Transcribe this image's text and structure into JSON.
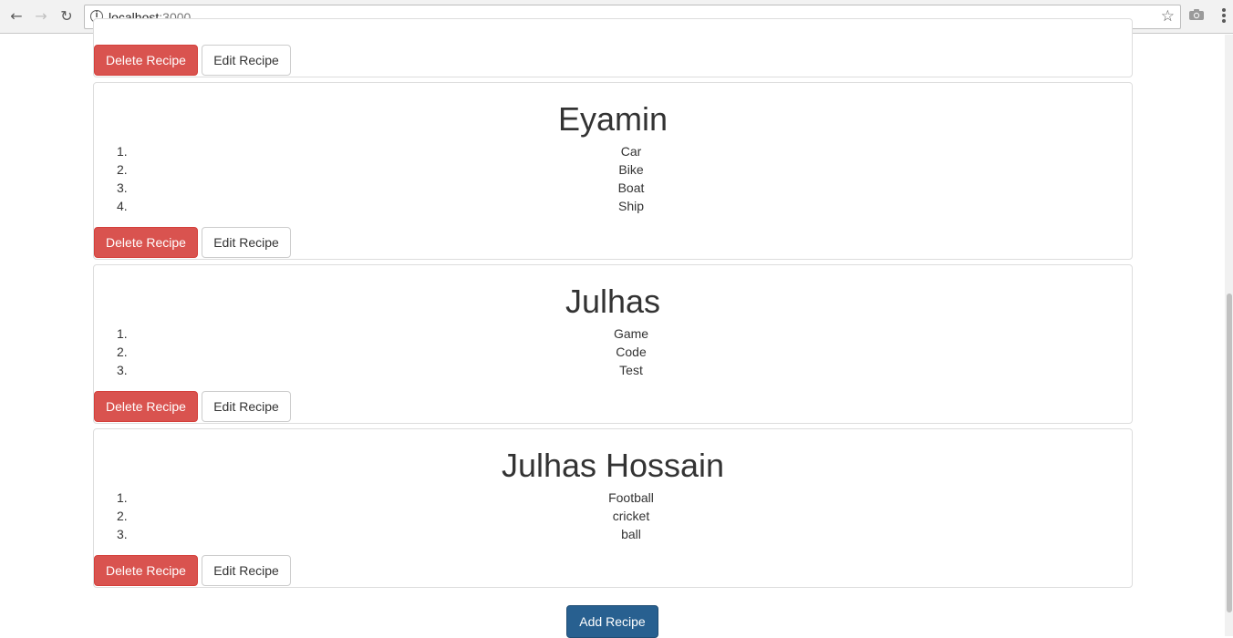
{
  "browser": {
    "url_host": "localhost",
    "url_port": ":3000",
    "back_glyph": "←",
    "forward_glyph": "→",
    "reload_glyph": "↻",
    "info_glyph": "i",
    "star_glyph": "☆"
  },
  "recipes": [
    {
      "title": "",
      "ingredients": [],
      "delete_label": "Delete Recipe",
      "edit_label": "Edit Recipe"
    },
    {
      "title": "Eyamin",
      "ingredients": [
        {
          "num": "1.",
          "name": "Car"
        },
        {
          "num": "2.",
          "name": "Bike"
        },
        {
          "num": "3.",
          "name": "Boat"
        },
        {
          "num": "4.",
          "name": "Ship"
        }
      ],
      "delete_label": "Delete Recipe",
      "edit_label": "Edit Recipe"
    },
    {
      "title": "Julhas",
      "ingredients": [
        {
          "num": "1.",
          "name": "Game"
        },
        {
          "num": "2.",
          "name": "Code"
        },
        {
          "num": "3.",
          "name": "Test"
        }
      ],
      "delete_label": "Delete Recipe",
      "edit_label": "Edit Recipe"
    },
    {
      "title": "Julhas Hossain",
      "ingredients": [
        {
          "num": "1.",
          "name": "Football"
        },
        {
          "num": "2.",
          "name": "cricket"
        },
        {
          "num": "3.",
          "name": "ball"
        }
      ],
      "delete_label": "Delete Recipe",
      "edit_label": "Edit Recipe"
    }
  ],
  "add_button_label": "Add Recipe",
  "colors": {
    "danger": "#d9534f",
    "primary": "#286090",
    "panel_border": "#dddddd"
  }
}
